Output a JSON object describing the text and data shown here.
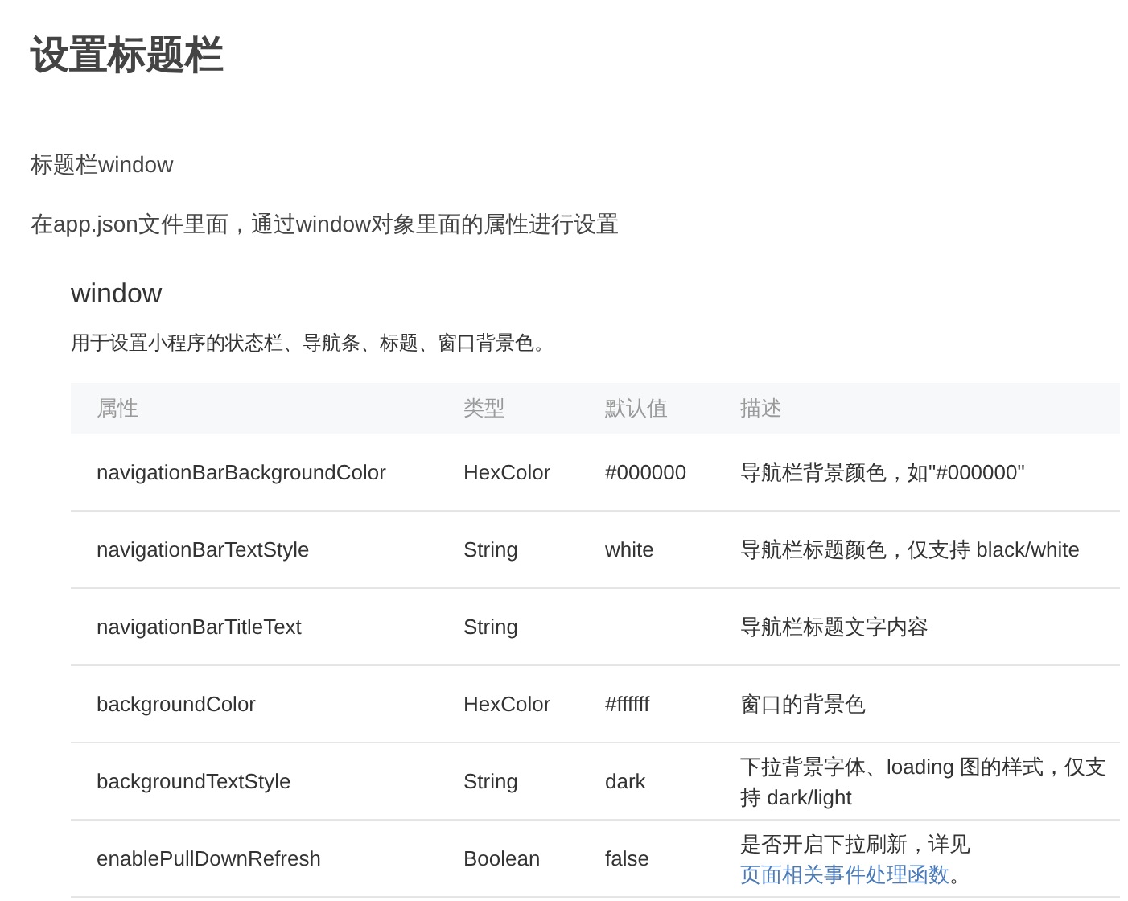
{
  "title": "设置标题栏",
  "paragraphs": [
    "标题栏window",
    "在app.json文件里面，通过window对象里面的属性进行设置"
  ],
  "section": {
    "heading": "window",
    "description": "用于设置小程序的状态栏、导航条、标题、窗口背景色。"
  },
  "table": {
    "columns": [
      "属性",
      "类型",
      "默认值",
      "描述"
    ],
    "rows": [
      {
        "property": "navigationBarBackgroundColor",
        "type": "HexColor",
        "default": "#000000",
        "description": "导航栏背景颜色，如\"#000000\""
      },
      {
        "property": "navigationBarTextStyle",
        "type": "String",
        "default": "white",
        "description": "导航栏标题颜色，仅支持 black/white"
      },
      {
        "property": "navigationBarTitleText",
        "type": "String",
        "description": "导航栏标题文字内容"
      },
      {
        "property": "backgroundColor",
        "type": "HexColor",
        "default": "#ffffff",
        "description": "窗口的背景色"
      },
      {
        "property": "backgroundTextStyle",
        "type": "String",
        "default": "dark",
        "description": "下拉背景字体、loading 图的样式，仅支持 dark/light"
      },
      {
        "property": "enablePullDownRefresh",
        "type": "Boolean",
        "default": "false",
        "description": "是否开启下拉刷新，详见",
        "link": "页面相关事件处理函数",
        "suffix": "。"
      }
    ]
  }
}
